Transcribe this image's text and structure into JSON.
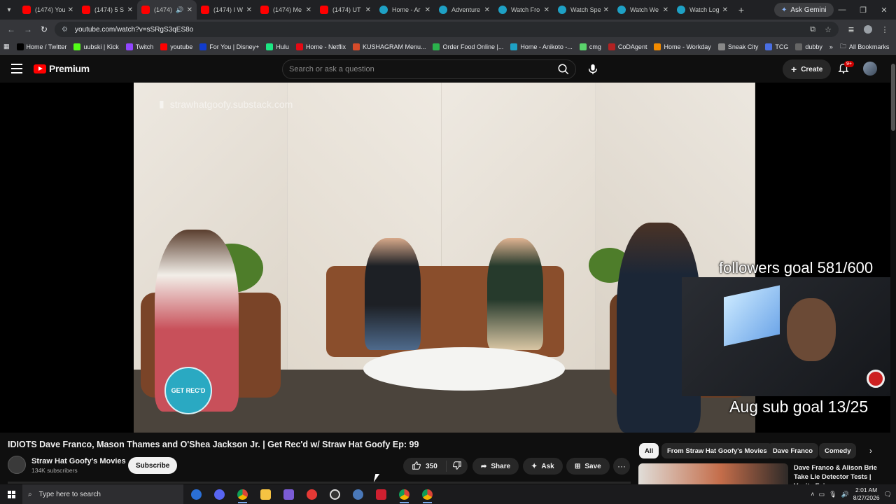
{
  "browser": {
    "tabs": [
      {
        "title": "(1474) You",
        "type": "yt",
        "active": false
      },
      {
        "title": "(1474) 5 S",
        "type": "yt",
        "active": false
      },
      {
        "title": "(1474)",
        "type": "yt",
        "active": true
      },
      {
        "title": "(1474) I W",
        "type": "yt",
        "active": false
      },
      {
        "title": "(1474) Me",
        "type": "yt",
        "active": false
      },
      {
        "title": "(1474) UT",
        "type": "yt",
        "active": false
      },
      {
        "title": "Home - Ar",
        "type": "globe",
        "active": false
      },
      {
        "title": "Adventure",
        "type": "globe",
        "active": false
      },
      {
        "title": "Watch Fro",
        "type": "globe",
        "active": false
      },
      {
        "title": "Watch Spe",
        "type": "globe",
        "active": false
      },
      {
        "title": "Watch We",
        "type": "globe",
        "active": false
      },
      {
        "title": "Watch Log",
        "type": "globe",
        "active": false
      }
    ],
    "ask_gemini": "Ask Gemini",
    "url": "youtube.com/watch?v=sSRgS3qES8o",
    "bookmarks": [
      {
        "label": "Home / Twitter",
        "color": "#000000"
      },
      {
        "label": "uubski | Kick",
        "color": "#53fc18"
      },
      {
        "label": "Twitch",
        "color": "#9146ff"
      },
      {
        "label": "youtube",
        "color": "#ff0000"
      },
      {
        "label": "For You | Disney+",
        "color": "#113ccf"
      },
      {
        "label": "Hulu",
        "color": "#1ce783"
      },
      {
        "label": "Home - Netflix",
        "color": "#e50914"
      },
      {
        "label": "KUSHAGRAM Menu...",
        "color": "#d64b2a"
      },
      {
        "label": "Order Food Online |...",
        "color": "#2bb24c"
      },
      {
        "label": "Home - Anikoto -...",
        "color": "#1ea1c5"
      },
      {
        "label": "cmg",
        "color": "#5ad36b"
      },
      {
        "label": "CoDAgent",
        "color": "#b22222"
      },
      {
        "label": "Home - Workday",
        "color": "#f38b00"
      },
      {
        "label": "Sneak City",
        "color": "#888888"
      },
      {
        "label": "TCG",
        "color": "#4a6fe3"
      },
      {
        "label": "dubby",
        "color": "#666666"
      }
    ],
    "all_bookmarks": "All Bookmarks"
  },
  "youtube": {
    "logo": "Premium",
    "search_placeholder": "Search or ask a question",
    "create": "Create",
    "notif_badge": "9+",
    "watermark": "strawhatgoofy.substack.com",
    "getrecd_logo": "GET REC'D",
    "overlay_followers": "followers goal 581/600",
    "overlay_subs": "Aug sub goal 13/25",
    "video_title": "IDIOTS Dave Franco, Mason Thames and O'Shea Jackson Jr. | Get Rec'd w/ Straw Hat Goofy Ep: 99",
    "channel_name": "Straw Hat Goofy's Movies",
    "channel_subs": "134K subscribers",
    "subscribe": "Subscribe",
    "likes": "350",
    "share": "Share",
    "ask": "Ask",
    "save": "Save",
    "chips": [
      "All",
      "From Straw Hat Goofy's Movies",
      "Dave Franco",
      "Comedy"
    ],
    "rec_title": "Dave Franco & Alison Brie Take Lie Detector Tests | Vanity Fair"
  },
  "taskbar": {
    "search_placeholder": "Type here to search",
    "time": "2:01 AM",
    "date": "8/27/2026"
  },
  "colors": {
    "yt_red": "#ff0000",
    "bg": "#0f0f0f"
  }
}
